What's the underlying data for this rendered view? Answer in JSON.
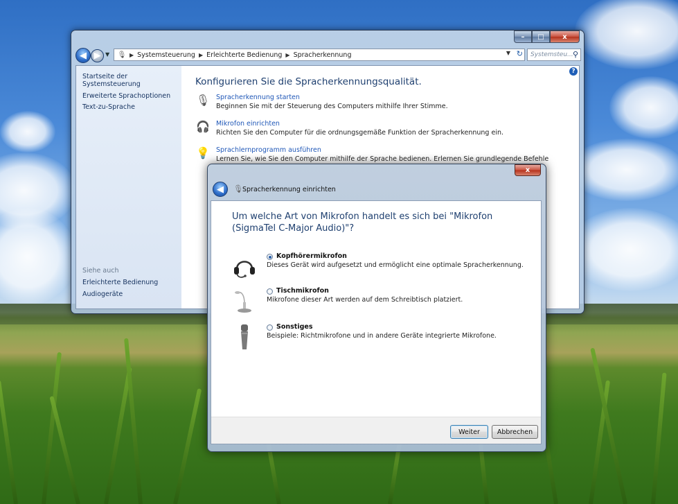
{
  "main_window": {
    "caption_buttons": {
      "minimize": "–",
      "maximize": "□",
      "close": "x"
    },
    "breadcrumbs": [
      "Systemsteuerung",
      "Erleichterte Bedienung",
      "Spracherkennung"
    ],
    "search_placeholder": "Systemsteu...",
    "sidebar": {
      "home_link": "Startseite der Systemsteuerung",
      "links": [
        "Erweiterte Sprachoptionen",
        "Text-zu-Sprache"
      ],
      "see_also_heading": "Siehe auch",
      "see_also_links": [
        "Erleichterte Bedienung",
        "Audiogeräte"
      ]
    },
    "title": "Konfigurieren Sie die Spracherkennungsqualität.",
    "tasks": [
      {
        "link": "Spracherkennung starten",
        "desc": "Beginnen Sie mit der Steuerung des Computers mithilfe Ihrer Stimme.",
        "icon": "microphone-icon"
      },
      {
        "link": "Mikrofon einrichten",
        "desc": "Richten Sie den Computer für die ordnungsgemäße Funktion der Spracherkennung ein.",
        "icon": "headset-icon"
      },
      {
        "link": "Sprachlernprogramm ausführen",
        "desc": "Lernen Sie, wie Sie den Computer mithilfe der Sprache bedienen. Erlernen Sie grundlegende Befehle",
        "icon": "lightbulb-icon"
      }
    ]
  },
  "dialog": {
    "close": "x",
    "title": "Spracherkennung einrichten",
    "question": "Um welche Art von Mikrofon handelt es sich bei \"Mikrofon (SigmaTel C-Major Audio)\"?",
    "options": [
      {
        "label": "Kopfhörermikrofon",
        "desc": "Dieses Gerät wird aufgesetzt und ermöglicht eine optimale Spracherkennung.",
        "checked": true,
        "icon": "headset-microphone-icon"
      },
      {
        "label": "Tischmikrofon",
        "desc": "Mikrofone dieser Art werden auf dem Schreibtisch platziert.",
        "checked": false,
        "icon": "desk-microphone-icon"
      },
      {
        "label": "Sonstiges",
        "desc": "Beispiele: Richtmikrofone und in andere Geräte integrierte Mikrofone.",
        "checked": false,
        "icon": "handheld-microphone-icon"
      }
    ],
    "buttons": {
      "next": "Weiter",
      "cancel": "Abbrechen"
    }
  }
}
